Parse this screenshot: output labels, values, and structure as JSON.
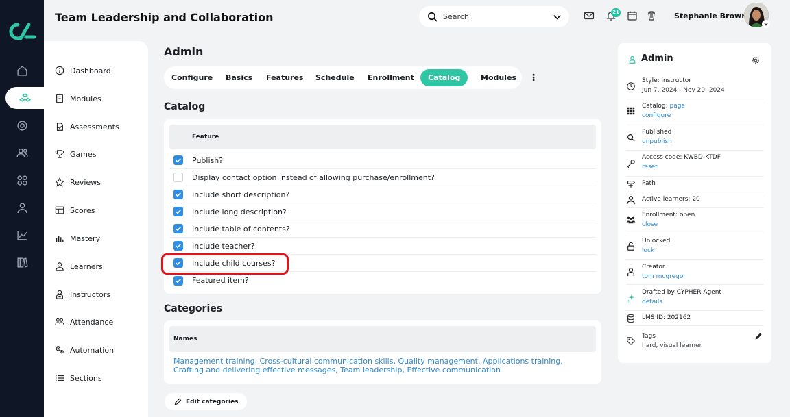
{
  "app": {
    "title": "Team Leadership and Collaboration"
  },
  "search": {
    "placeholder": "Search"
  },
  "notifications": {
    "count": "21"
  },
  "user": {
    "name": "Stephanie Brown"
  },
  "sidebar": {
    "items": [
      {
        "label": "Dashboard",
        "icon": "info-circle-icon"
      },
      {
        "label": "Modules",
        "icon": "book-icon"
      },
      {
        "label": "Assessments",
        "icon": "clipboard-icon"
      },
      {
        "label": "Games",
        "icon": "trophy-icon"
      },
      {
        "label": "Reviews",
        "icon": "star-icon"
      },
      {
        "label": "Scores",
        "icon": "table-icon"
      },
      {
        "label": "Mastery",
        "icon": "bar-chart-icon"
      },
      {
        "label": "Learners",
        "icon": "user-icon"
      },
      {
        "label": "Instructors",
        "icon": "instructor-icon"
      },
      {
        "label": "Attendance",
        "icon": "group-icon"
      },
      {
        "label": "Automation",
        "icon": "gears-icon"
      },
      {
        "label": "Sections",
        "icon": "list-icon"
      }
    ]
  },
  "main": {
    "heading": "Admin",
    "tabs": [
      "Configure",
      "Basics",
      "Features",
      "Schedule",
      "Enrollment",
      "Catalog",
      "Modules"
    ],
    "active_tab": "Catalog",
    "catalog": {
      "heading": "Catalog",
      "column": "Feature",
      "rows": [
        {
          "label": "Publish?",
          "checked": true
        },
        {
          "label": "Display contact option instead of allowing purchase/enrollment?",
          "checked": false
        },
        {
          "label": "Include short description?",
          "checked": true
        },
        {
          "label": "Include long description?",
          "checked": true
        },
        {
          "label": "Include table of contents?",
          "checked": true
        },
        {
          "label": "Include teacher?",
          "checked": true
        },
        {
          "label": "Include child courses?",
          "checked": true
        },
        {
          "label": "Featured item?",
          "checked": true
        }
      ]
    },
    "categories": {
      "heading": "Categories",
      "column": "Names",
      "items": [
        "Management training",
        "Cross-cultural communication skills",
        "Quality management",
        "Applications training",
        "Crafting and delivering effective messages",
        "Team leadership",
        "Effective communication"
      ],
      "edit_label": "Edit categories"
    }
  },
  "right_panel": {
    "title": "Admin",
    "style": {
      "label": "Style: instructor",
      "dates": "Jun 7, 2024 - Nov 20, 2024"
    },
    "catalog": {
      "label": "Catalog:",
      "page_link": "page",
      "configure_link": "configure"
    },
    "published": {
      "label": "Published",
      "action": "unpublish"
    },
    "access": {
      "label": "Access code: KWBD-KTDF",
      "action": "reset"
    },
    "path": {
      "label": "Path"
    },
    "active_learners": {
      "label": "Active learners: 20"
    },
    "enrollment": {
      "label": "Enrollment: open",
      "action": "close"
    },
    "unlocked": {
      "label": "Unlocked",
      "action": "lock"
    },
    "creator": {
      "label": "Creator",
      "name": "tom mcgregor"
    },
    "drafted": {
      "label": "Drafted by CYPHER Agent",
      "action": "details"
    },
    "lms_id": {
      "label": "LMS ID: 202162"
    },
    "tags": {
      "label": "Tags",
      "value": "hard, visual learner"
    }
  },
  "colors": {
    "accent": "#2fc7a3",
    "link": "#2e8bd4",
    "checkbox": "#2f8ee6",
    "rail": "#0f1626",
    "highlight": "#e0141a"
  }
}
